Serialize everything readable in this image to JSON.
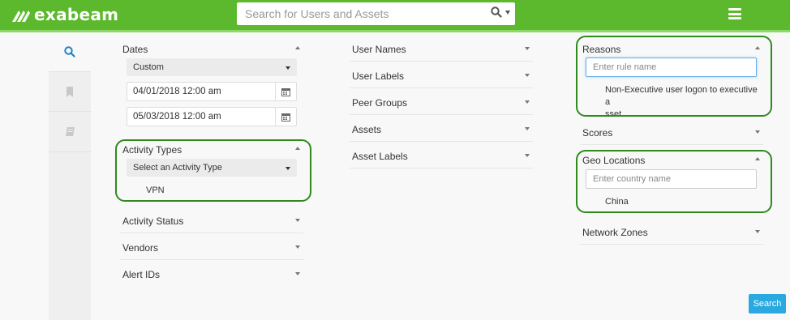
{
  "app": {
    "brand": "exabeam",
    "brand_color": "#5cb82c",
    "accent_color": "#29a9e0"
  },
  "header": {
    "search_placeholder": "Search for Users and Assets",
    "search_icon": "search-icon",
    "menu_icon": "hamburger-menu-icon"
  },
  "sidebar": {
    "items": [
      {
        "icon": "search-icon",
        "active": true
      },
      {
        "icon": "bookmark-icon",
        "active": false
      },
      {
        "icon": "notebook-icon",
        "active": false
      }
    ]
  },
  "col1": {
    "dates": {
      "label": "Dates",
      "range_type": "Custom",
      "start": "04/01/2018 12:00 am",
      "end": "05/03/2018 12:00 am"
    },
    "activity_types": {
      "label": "Activity Types",
      "select_placeholder": "Select an Activity Type",
      "selected": "VPN"
    },
    "activity_status": {
      "label": "Activity Status"
    },
    "vendors": {
      "label": "Vendors"
    },
    "alert_ids": {
      "label": "Alert IDs"
    }
  },
  "col2": {
    "user_names": {
      "label": "User Names"
    },
    "user_labels": {
      "label": "User Labels"
    },
    "peer_groups": {
      "label": "Peer Groups"
    },
    "assets": {
      "label": "Assets"
    },
    "asset_labels": {
      "label": "Asset Labels"
    }
  },
  "col3": {
    "reasons": {
      "label": "Reasons",
      "placeholder": "Enter rule name",
      "selected_line1": "Non-Executive user logon to executive a",
      "selected_line2": "sset"
    },
    "scores": {
      "label": "Scores"
    },
    "geo_locations": {
      "label": "Geo Locations",
      "placeholder": "Enter country name",
      "selected": "China"
    },
    "network_zones": {
      "label": "Network Zones"
    }
  },
  "actions": {
    "search_label": "Search"
  }
}
